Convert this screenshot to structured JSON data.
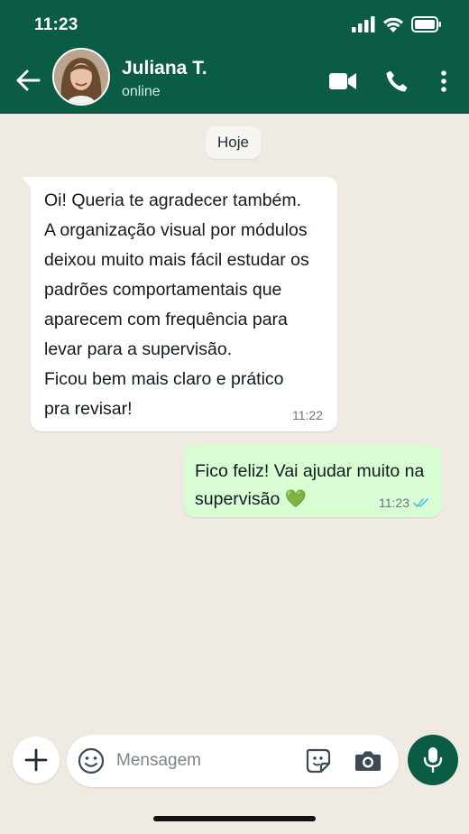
{
  "colors": {
    "header": "#0b5c45",
    "chat_background": "#efeae2",
    "incoming_bubble": "#ffffff",
    "outgoing_bubble": "#d9fdd3",
    "read_ticks": "#53bdeb"
  },
  "status_bar": {
    "time": "11:23",
    "icons": [
      "signal-icon",
      "wifi-icon",
      "battery-icon"
    ]
  },
  "header": {
    "contact_name": "Juliana T.",
    "contact_status": "online",
    "icons": [
      "back-arrow-icon",
      "avatar",
      "video-call-icon",
      "phone-call-icon",
      "more-options-icon"
    ]
  },
  "chat": {
    "date_label": "Hoje",
    "messages": [
      {
        "direction": "incoming",
        "text": "Oi! Queria te agradecer também.\nA organização visual por módulos\ndeixou muito mais fácil estudar os\npadrões comportamentais que\naparecem com frequência para\nlevar para a supervisão.\nFicou bem mais claro e prático\npra revisar!",
        "time": "11:22"
      },
      {
        "direction": "outgoing",
        "text": "Fico feliz! Vai ajudar muito na supervisão 💚",
        "time": "11:23",
        "status_icon": "double-check-read-icon"
      }
    ]
  },
  "composer": {
    "placeholder": "Mensagem",
    "icons": [
      "plus-icon",
      "emoji-icon",
      "sticker-icon",
      "camera-icon",
      "microphone-icon"
    ]
  }
}
